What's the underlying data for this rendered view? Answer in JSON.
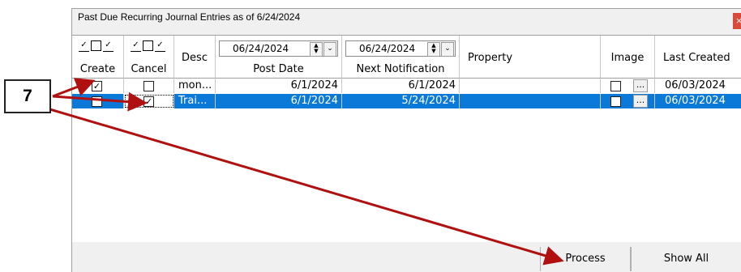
{
  "window": {
    "title": "Past Due Recurring Journal Entries as of 6/24/2024",
    "close_label": "×"
  },
  "columns": {
    "create": "Create",
    "cancel": "Cancel",
    "desc": "Desc",
    "post_date": "Post Date",
    "post_date_value": "06/24/2024",
    "next_notification": "Next Notification",
    "next_notification_value": "06/24/2024",
    "property": "Property",
    "image": "Image",
    "last_created": "Last Created"
  },
  "header_checks": {
    "checked_glyph": "✓",
    "unchecked_glyph": ""
  },
  "rows": [
    {
      "create_checked": true,
      "cancel_checked": false,
      "desc": "mon...",
      "post_date": "6/1/2024",
      "next_notification": "6/1/2024",
      "property": "",
      "image_btn": "...",
      "last_created": "06/03/2024"
    },
    {
      "create_checked": false,
      "cancel_checked": true,
      "desc": "Trai...",
      "post_date": "6/1/2024",
      "next_notification": "5/24/2024",
      "property": "",
      "image_btn": "...",
      "last_created": "06/03/2024"
    }
  ],
  "rows_display": [
    {
      "create_mark": "✓",
      "cancel_mark": ""
    },
    {
      "create_mark": "",
      "cancel_mark": "✓"
    }
  ],
  "buttons": {
    "process": "Process",
    "show_all": "Show All"
  },
  "annotation": {
    "step_number": "7",
    "arrow_color": "#b01010",
    "highlight_color": "#0a79d8"
  }
}
